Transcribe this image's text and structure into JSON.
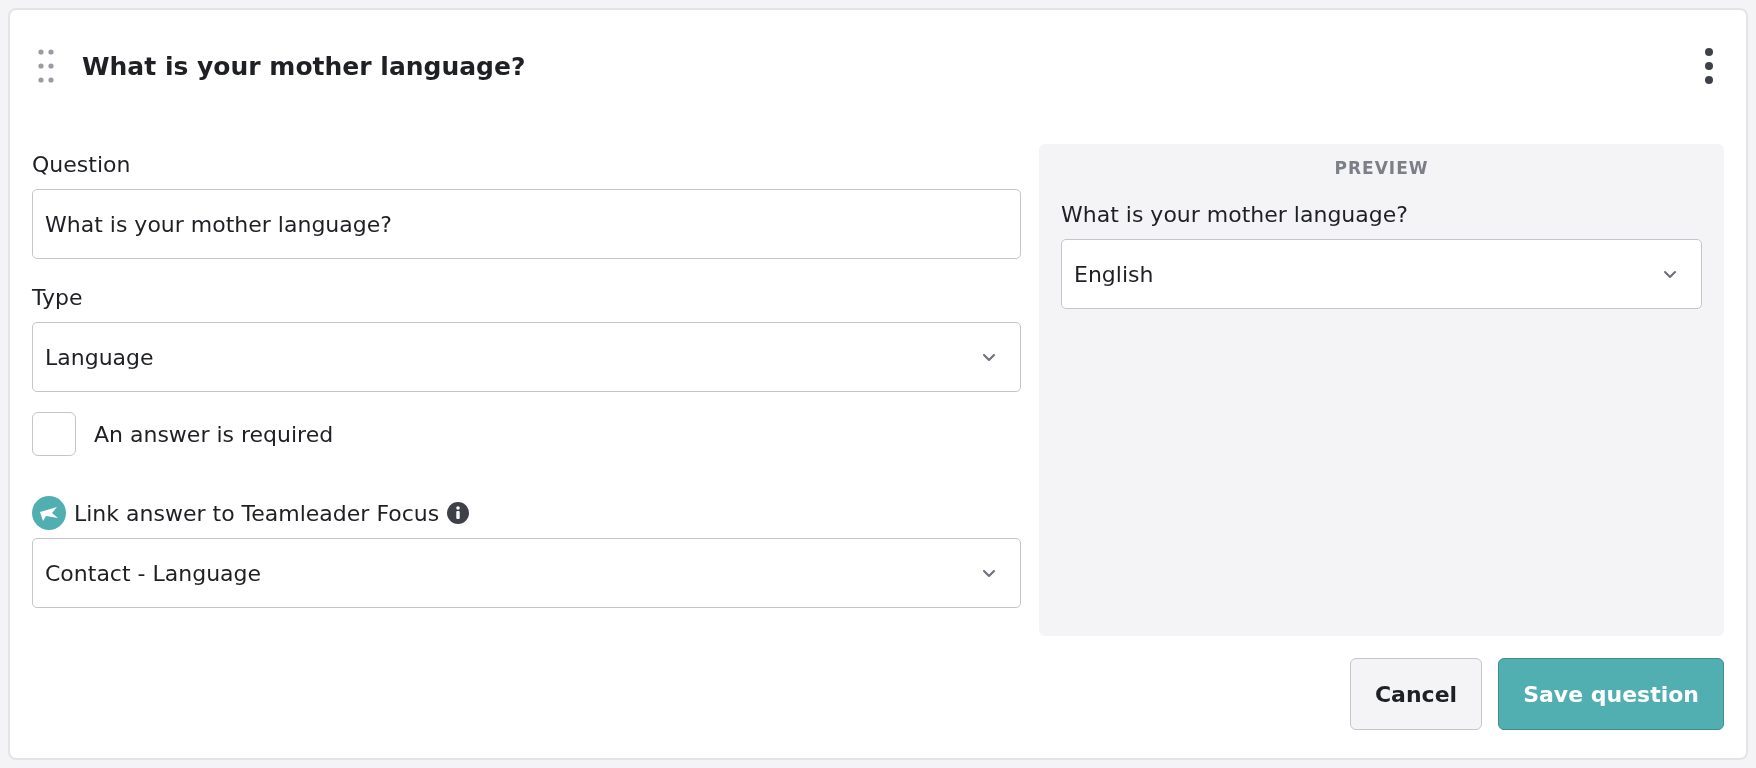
{
  "header": {
    "title": "What is your mother language?"
  },
  "form": {
    "question": {
      "label": "Question",
      "value": "What is your mother language?"
    },
    "type": {
      "label": "Type",
      "value": "Language"
    },
    "required": {
      "label": "An answer is required",
      "checked": false
    },
    "link": {
      "label": "Link answer to Teamleader Focus",
      "value": "Contact - Language"
    }
  },
  "preview": {
    "heading": "PREVIEW",
    "question": "What is your mother language?",
    "value": "English"
  },
  "buttons": [
    {
      "label": "Cancel",
      "kind": "secondary"
    },
    {
      "label": "Save question",
      "kind": "primary"
    }
  ]
}
